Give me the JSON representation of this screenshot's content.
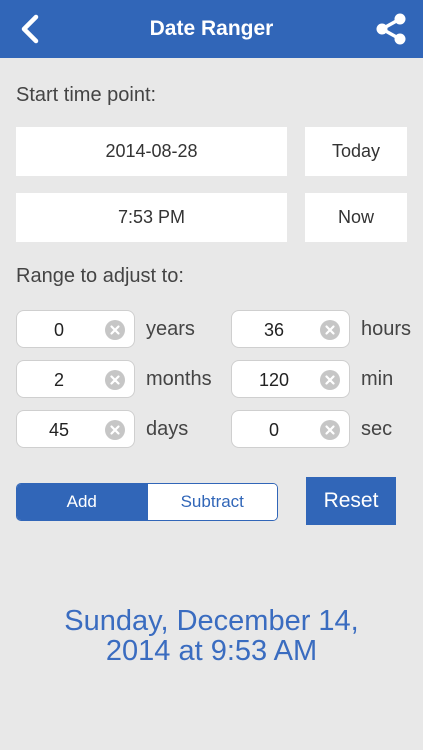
{
  "header": {
    "title": "Date Ranger",
    "back_icon": "back-chevron-icon",
    "share_icon": "share-icon",
    "color": "#3166b8"
  },
  "start": {
    "label": "Start time point:",
    "date_value": "2014-08-28",
    "today_label": "Today",
    "time_value": "7:53 PM",
    "now_label": "Now"
  },
  "range": {
    "label": "Range to adjust to:",
    "years": {
      "value": "0",
      "unit": "years"
    },
    "months": {
      "value": "2",
      "unit": "months"
    },
    "days": {
      "value": "45",
      "unit": "days"
    },
    "hours": {
      "value": "36",
      "unit": "hours"
    },
    "min": {
      "value": "120",
      "unit": "min"
    },
    "sec": {
      "value": "0",
      "unit": "sec"
    },
    "clear_icon": "clear-icon"
  },
  "mode": {
    "add_label": "Add",
    "subtract_label": "Subtract",
    "selected": "Add"
  },
  "reset_label": "Reset",
  "result": {
    "line1": "Sunday, December 14,",
    "line2": "2014 at 9:53 AM"
  }
}
